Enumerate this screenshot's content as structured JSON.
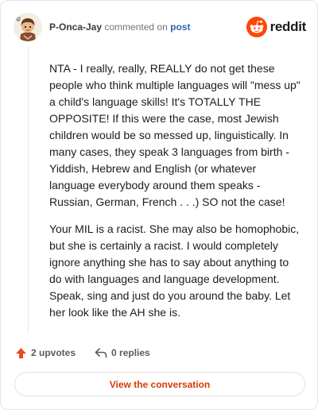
{
  "header": {
    "username": "P-Onca-Jay",
    "commented_text": "commented on",
    "post_link": "post",
    "brand_word": "reddit",
    "brand_logo_icon": "reddit-alien-logo",
    "brand_color": "#ff4500"
  },
  "comment": {
    "paragraphs": [
      "NTA - I really, really, REALLY do not get these people who think multiple languages will \"mess up\" a child's language skills! It's TOTALLY THE OPPOSITE! If this were the case, most Jewish children would be so messed up, linguistically. In many cases, they speak 3 languages from birth - Yiddish, Hebrew and English (or whatever language everybody around them speaks - Russian, German, French . . .) SO not the case!",
      "Your MIL is a racist. She may also be homophobic, but she is certainly a racist. I would completely ignore anything she has to say about anything to do with languages and language development. Speak, sing and just do you around the baby. Let her look like the AH she is."
    ]
  },
  "actions": {
    "upvote_icon": "upvote-arrow-icon",
    "upvotes_label": "2 upvotes",
    "reply_icon": "reply-arrow-icon",
    "replies_label": "0 replies"
  },
  "footer": {
    "view_button_label": "View the conversation",
    "accent_color": "#d93900"
  }
}
